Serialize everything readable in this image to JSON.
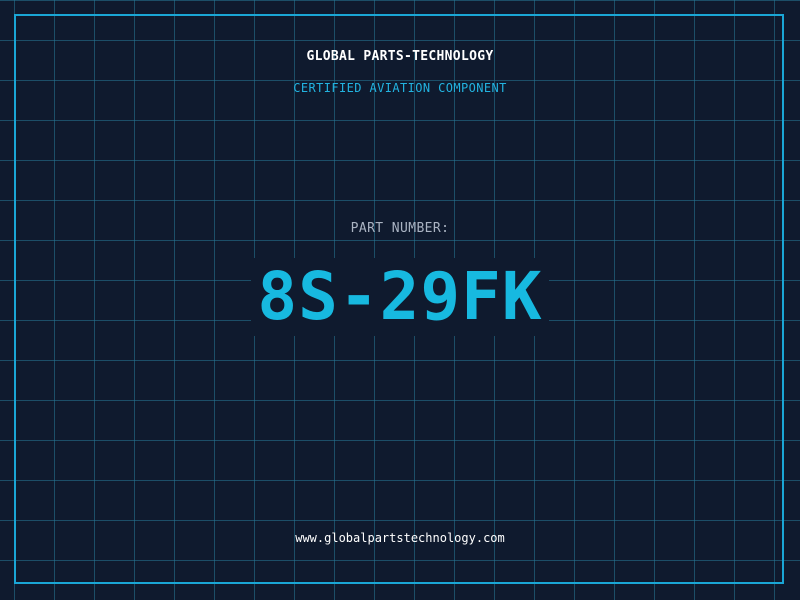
{
  "label": {
    "company": "GLOBAL PARTS-TECHNOLOGY",
    "subtitle": "CERTIFIED AVIATION COMPONENT",
    "part_label": "PART NUMBER:",
    "part_number": "8S-29FK",
    "website": "www.globalpartstechnology.com"
  },
  "colors": {
    "background": "#0f1a2e",
    "grid": "#26788f",
    "border": "#1aa6d6",
    "accent": "#17b9e0",
    "text_primary": "#ffffff",
    "text_muted": "#aab3c2"
  }
}
